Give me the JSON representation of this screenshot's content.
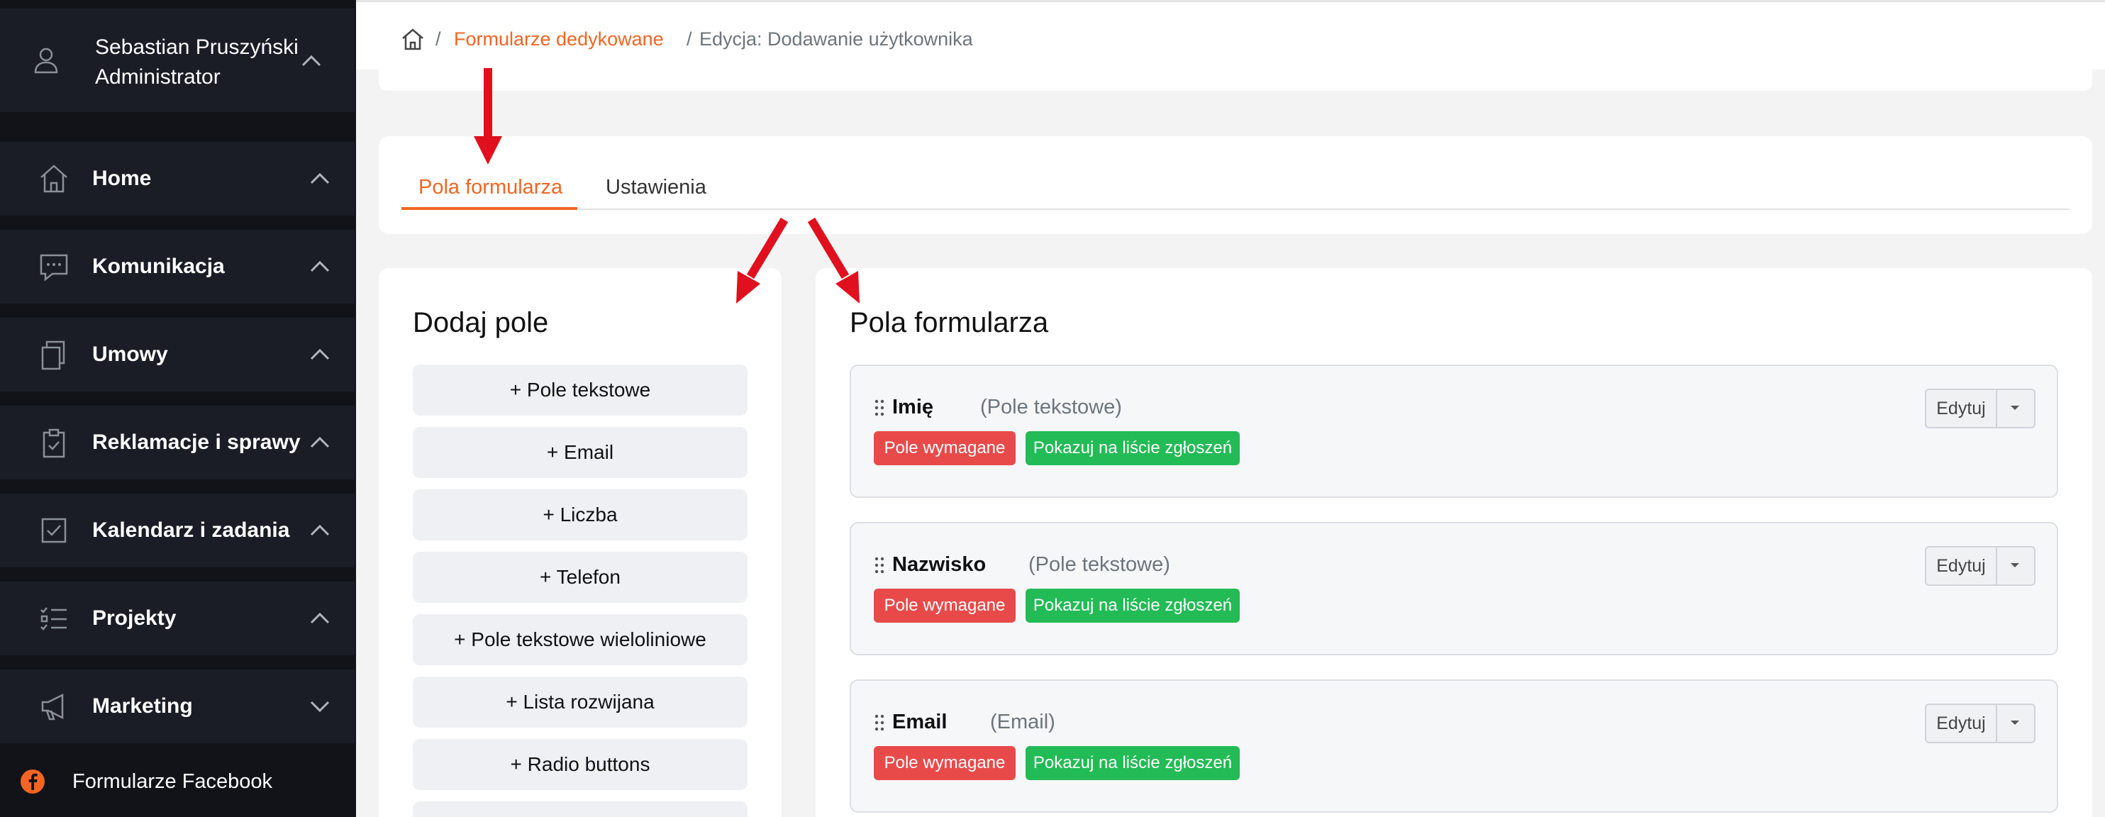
{
  "user": {
    "name": "Sebastian Pruszyński",
    "role": "Administrator"
  },
  "sidebar": {
    "items": [
      {
        "label": "Home",
        "icon": "home-icon"
      },
      {
        "label": "Komunikacja",
        "icon": "chat-icon"
      },
      {
        "label": "Umowy",
        "icon": "documents-icon"
      },
      {
        "label": "Reklamacje i sprawy",
        "icon": "clipboard-check-icon"
      },
      {
        "label": "Kalendarz i zadania",
        "icon": "checkbox-icon"
      },
      {
        "label": "Projekty",
        "icon": "task-list-icon"
      },
      {
        "label": "Marketing",
        "icon": "megaphone-icon"
      }
    ],
    "facebook_label": "Formularze Facebook"
  },
  "breadcrumb": {
    "link": "Formularze dedykowane",
    "current": "Edycja: Dodawanie użytkownika"
  },
  "tabs": {
    "active": "Pola formularza",
    "inactive": "Ustawienia"
  },
  "add_panel": {
    "title": "Dodaj pole",
    "buttons": [
      "+ Pole tekstowe",
      "+ Email",
      "+ Liczba",
      "+ Telefon",
      "+ Pole tekstowe wieloliniowe",
      "+ Lista rozwijana",
      "+ Radio buttons"
    ]
  },
  "fields_panel": {
    "title": "Pola formularza",
    "fields": [
      {
        "name": "Imię",
        "type": "(Pole tekstowe)"
      },
      {
        "name": "Nazwisko",
        "type": "(Pole tekstowe)"
      },
      {
        "name": "Email",
        "type": "(Email)"
      }
    ],
    "badge_required": "Pole wymagane",
    "badge_list": "Pokazuj na liście zgłoszeń",
    "edit_label": "Edytuj"
  },
  "colors": {
    "accent": "#f26522",
    "sidebar_bg": "#111319",
    "badge_red": "#e84a4a",
    "badge_green": "#22bb55",
    "annotation_arrow": "#e0101e"
  }
}
